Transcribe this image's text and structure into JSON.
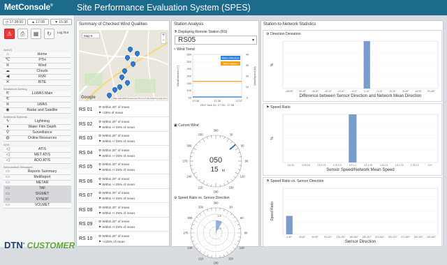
{
  "header": {
    "logo": "MetConsole",
    "logo_mark": "®",
    "title": "Site Performance Evaluation System (SPES)"
  },
  "sidebar": {
    "times": [
      "17:38:00",
      "17:08",
      "15:38"
    ],
    "logout": "Log Out",
    "groups": [
      {
        "title": "AWOS",
        "items": [
          {
            "label": "Home",
            "icon": "home-icon",
            "glyph": "⌂"
          },
          {
            "label": "PTH",
            "icon": "pth-icon",
            "glyph": "℃"
          },
          {
            "label": "Wind",
            "icon": "wind-icon",
            "glyph": "≋"
          },
          {
            "label": "Clouds",
            "icon": "cloud-icon",
            "glyph": "☁"
          },
          {
            "label": "RVR",
            "icon": "rvr-icon",
            "glyph": "◀"
          },
          {
            "label": "BITE",
            "icon": "bite-icon",
            "glyph": "✕"
          }
        ]
      },
      {
        "title": "Windshear Alerting",
        "items": [
          {
            "label": "LLWAS Main",
            "icon": "llwas-icon",
            "glyph": "⚟"
          },
          {
            "label": "",
            "icon": "wind-alert-icon",
            "glyph": "⚟"
          },
          {
            "label": "LWAS",
            "icon": "lwas-icon",
            "glyph": "≋"
          },
          {
            "label": "Radar and Satellite",
            "icon": "radar-icon",
            "glyph": "◉"
          }
        ]
      },
      {
        "title": "Additional Systems",
        "items": [
          {
            "label": "Lightning",
            "icon": "lightning-icon",
            "glyph": "ϟ"
          },
          {
            "label": "Water Film Depth",
            "icon": "water-icon",
            "glyph": "♦"
          },
          {
            "label": "Surveillance",
            "icon": "surveillance-icon",
            "glyph": "⚲"
          },
          {
            "label": "Online Resources",
            "icon": "globe-icon",
            "glyph": "◍"
          }
        ]
      },
      {
        "title": "ATIS",
        "items": [
          {
            "label": "ATIS",
            "icon": "atis-icon",
            "glyph": "◁"
          },
          {
            "label": "MET ATIS",
            "icon": "met-atis-icon",
            "glyph": "◁"
          },
          {
            "label": "ADO ATIS",
            "icon": "ado-atis-icon",
            "glyph": "◁"
          }
        ]
      },
      {
        "title": "Aeronautical Messages",
        "items": [
          {
            "label": "Reports Summary",
            "icon": "message-icon",
            "glyph": "▭"
          },
          {
            "label": "MetReport",
            "icon": "message-icon",
            "glyph": "▭"
          },
          {
            "label": "METAR",
            "icon": "message-icon",
            "glyph": "▭"
          },
          {
            "label": "TAF",
            "icon": "message-icon",
            "glyph": "▭"
          },
          {
            "label": "SIGMET",
            "icon": "message-icon",
            "glyph": "▭"
          },
          {
            "label": "SYNOP",
            "icon": "message-icon",
            "glyph": "▭"
          },
          {
            "label": "VOLMET",
            "icon": "message-icon",
            "glyph": "▭"
          }
        ]
      }
    ],
    "brand": "DTN",
    "brand_mark": "®",
    "brand2": "CUSTOMER"
  },
  "summary": {
    "title": "Summary of Checked Wind Qualities",
    "map": {
      "type_label": "Map",
      "plus": "+",
      "minus": "−",
      "attribution": "Map data  2018 Government  Terms of Use  Report a map error",
      "google": "Google"
    },
    "stations": [
      {
        "name": "RS 01",
        "line1": "Within 20° of mean",
        "line2": "<25% of mean"
      },
      {
        "name": "RS 02",
        "line1": "Within 20° of mean",
        "line2": "Within +/-25% of mean"
      },
      {
        "name": "RS 03",
        "line1": "Within 20° of mean",
        "line2": "Within +/-25% of mean"
      },
      {
        "name": "RS 04",
        "line1": "Within 20° of mean",
        "line2": "Within +/-25% of mean"
      },
      {
        "name": "RS 05",
        "line1": "Within 20° of mean",
        "line2": "Within +/-25% of mean"
      },
      {
        "name": "RS 06",
        "line1": "Within 20° of mean",
        "line2": "Within +/-25% of mean"
      },
      {
        "name": "RS 07",
        "line1": "Within 20° of mean",
        "line2": "Within +/-25% of mean"
      },
      {
        "name": "RS 08",
        "line1": "Within 20° of mean",
        "line2": "Within +/-25% of mean"
      },
      {
        "name": "RS 09",
        "line1": "Within 20° of mean",
        "line2": "Within +/-25% of mean"
      },
      {
        "name": "RS 10",
        "line1": "Within 20° of mean",
        "line2": ">125% of mean"
      }
    ]
  },
  "analysis": {
    "title": "Station Analysis",
    "remote_label": "Displaying Remote Station (RS)",
    "remote_value": "RS05",
    "trend": {
      "title": "Wind Trend",
      "legend_dir": "Wind direction",
      "legend_speed": "Wind speed",
      "ylabel_left": "WindDirection (°)",
      "ylabel_right": "WindSpeed (kt)",
      "left_ticks": [
        "350",
        "300",
        "250",
        "200",
        "150",
        "100",
        "50"
      ],
      "right_ticks": [
        "40",
        "30",
        "20",
        "10",
        "0"
      ],
      "x_ticks": [
        "17:36",
        "17:36",
        "17:37"
      ],
      "x_sub": "2017 Nov 20, 17:35 - 17:38"
    },
    "current": {
      "title": "Current Wind",
      "direction": "050",
      "speed": "15",
      "unit": "kt",
      "ticks": [
        "360",
        "330",
        "300",
        "270",
        "240",
        "210",
        "180",
        "150",
        "120",
        "90",
        "60",
        "30"
      ]
    },
    "ratio": {
      "title": "Speed Ratio vs. Sensor Direction",
      "rings": [
        "1.5",
        "1.0",
        "0.5"
      ],
      "ticks": [
        "360",
        "330",
        "300",
        "270",
        "240",
        "210",
        "180",
        "150",
        "120",
        "90",
        "60",
        "30"
      ]
    }
  },
  "network": {
    "title": "Station-to-Network Statistics"
  },
  "chart_data": [
    {
      "type": "bar",
      "title": "Direction Deviation",
      "ylabel": "%",
      "xlabel": "Difference between Sensor Direction and Network Mean Direction",
      "categories": [
        "-180-90°",
        "-90-45°",
        "-45-30°",
        "-30-20°",
        "-20-10°",
        "-10-0°",
        "0-10°",
        "10-20°",
        "20-30°",
        "30-45°",
        "45-90°",
        "90-180°"
      ],
      "values": [
        0,
        0,
        0,
        0,
        0,
        0,
        100,
        0,
        0,
        0,
        0,
        0
      ],
      "ylim": [
        0,
        100
      ]
    },
    {
      "type": "bar",
      "title": "Speed Ratio",
      "ylabel": "%",
      "xlabel": "Sensor Speed/Network Mean Speed",
      "categories": [
        "0-0.25",
        "0.25-0.5",
        "0.5-0.75",
        "0.75-0.9",
        "0.9-1.1",
        "1.1-1.25",
        "1.25-1.5",
        "1.5-1.75",
        "1.75-2.0",
        "2.0+"
      ],
      "values": [
        0,
        0,
        0,
        0,
        100,
        0,
        0,
        0,
        0,
        0
      ],
      "ylim": [
        0,
        100
      ]
    },
    {
      "type": "bar",
      "title": "Speed Ratio vs. Sensor Direction",
      "ylabel": "Speed Ratio",
      "xlabel": "Sensor Direction",
      "categories": [
        "0-30°",
        "30-60°",
        "60-90°",
        "90-120°",
        "120-150°",
        "150-180°",
        "180-210°",
        "210-240°",
        "240-270°",
        "270-300°",
        "300-330°",
        "330-360°"
      ],
      "values": [
        1.0,
        0,
        0,
        0,
        0,
        0,
        0,
        0,
        0,
        0,
        0,
        0
      ],
      "ylim": [
        0,
        2.5
      ]
    }
  ],
  "colors": {
    "header": "#1c6a8c",
    "accent": "#7a9ccb",
    "marker": "#2d7fd8",
    "dir_line": "#2e7fd6",
    "speed_line": "#f59d0e",
    "alert": "#e53935"
  }
}
